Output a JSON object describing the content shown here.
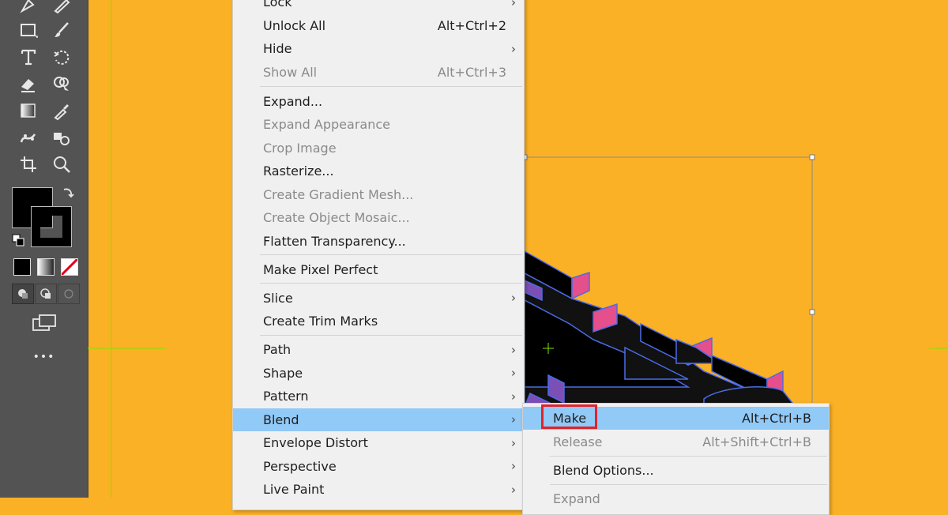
{
  "colors": {
    "canvas": "#FBB125",
    "toolbar": "#535353",
    "menu_bg": "#F0F0F0",
    "highlight": "#91C9F7",
    "make_outline": "#E0232C",
    "guide": "#7CE600"
  },
  "toolbar": {
    "tools": [
      "pen-icon",
      "pencil-icon",
      "rectangle-icon",
      "brush-icon",
      "type-icon",
      "rotate-icon",
      "eraser-icon",
      "shape-builder-icon",
      "gradient-icon",
      "eyedropper-icon",
      "puppet-warp-icon",
      "live-paint-icon",
      "artboard-icon",
      "zoom-icon"
    ],
    "more_label": "•••"
  },
  "menu": {
    "items": [
      {
        "label": "Lock",
        "shortcut": "",
        "submenu": true,
        "disabled": false
      },
      {
        "label": "Unlock All",
        "shortcut": "Alt+Ctrl+2",
        "submenu": false,
        "disabled": false
      },
      {
        "label": "Hide",
        "shortcut": "",
        "submenu": true,
        "disabled": false
      },
      {
        "label": "Show All",
        "shortcut": "Alt+Ctrl+3",
        "submenu": false,
        "disabled": true
      },
      {
        "label": "Expand...",
        "shortcut": "",
        "submenu": false,
        "disabled": false
      },
      {
        "label": "Expand Appearance",
        "shortcut": "",
        "submenu": false,
        "disabled": true
      },
      {
        "label": "Crop Image",
        "shortcut": "",
        "submenu": false,
        "disabled": true
      },
      {
        "label": "Rasterize...",
        "shortcut": "",
        "submenu": false,
        "disabled": false
      },
      {
        "label": "Create Gradient Mesh...",
        "shortcut": "",
        "submenu": false,
        "disabled": true
      },
      {
        "label": "Create Object Mosaic...",
        "shortcut": "",
        "submenu": false,
        "disabled": true
      },
      {
        "label": "Flatten Transparency...",
        "shortcut": "",
        "submenu": false,
        "disabled": false
      },
      {
        "label": "Make Pixel Perfect",
        "shortcut": "",
        "submenu": false,
        "disabled": false
      },
      {
        "label": "Slice",
        "shortcut": "",
        "submenu": true,
        "disabled": false
      },
      {
        "label": "Create Trim Marks",
        "shortcut": "",
        "submenu": false,
        "disabled": false
      },
      {
        "label": "Path",
        "shortcut": "",
        "submenu": true,
        "disabled": false
      },
      {
        "label": "Shape",
        "shortcut": "",
        "submenu": true,
        "disabled": false
      },
      {
        "label": "Pattern",
        "shortcut": "",
        "submenu": true,
        "disabled": false
      },
      {
        "label": "Blend",
        "shortcut": "",
        "submenu": true,
        "disabled": false,
        "highlighted": true
      },
      {
        "label": "Envelope Distort",
        "shortcut": "",
        "submenu": true,
        "disabled": false
      },
      {
        "label": "Perspective",
        "shortcut": "",
        "submenu": true,
        "disabled": false
      },
      {
        "label": "Live Paint",
        "shortcut": "",
        "submenu": true,
        "disabled": false
      }
    ]
  },
  "submenu": {
    "items": [
      {
        "label": "Make",
        "shortcut": "Alt+Ctrl+B",
        "disabled": false,
        "highlighted": true
      },
      {
        "label": "Release",
        "shortcut": "Alt+Shift+Ctrl+B",
        "disabled": true
      },
      {
        "label": "Blend Options...",
        "shortcut": "",
        "disabled": false
      },
      {
        "label": "Expand",
        "shortcut": "",
        "disabled": true
      }
    ]
  }
}
